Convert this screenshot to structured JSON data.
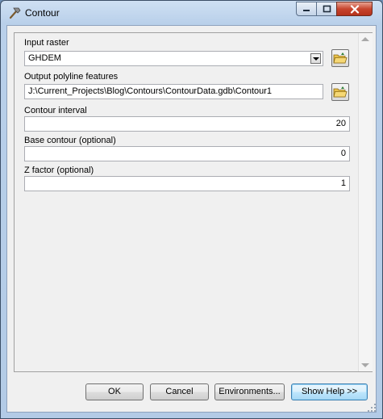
{
  "window": {
    "title": "Contour"
  },
  "form": {
    "input_raster_label": "Input raster",
    "input_raster_value": "GHDEM",
    "output_label": "Output polyline features",
    "output_value": "J:\\Current_Projects\\Blog\\Contours\\ContourData.gdb\\Contour1",
    "interval_label": "Contour interval",
    "interval_value": "20",
    "base_label": "Base contour (optional)",
    "base_value": "0",
    "zfactor_label": "Z factor (optional)",
    "zfactor_value": "1"
  },
  "buttons": {
    "ok": "OK",
    "cancel": "Cancel",
    "environments": "Environments...",
    "help": "Show Help >>"
  },
  "icons": {
    "title": "hammer-icon",
    "browse": "open-folder-icon"
  }
}
